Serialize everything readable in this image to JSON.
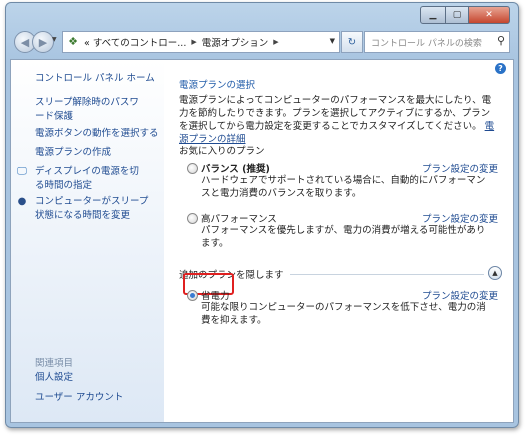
{
  "window": {
    "caption_buttons": {
      "minimize": "▁",
      "maximize": "▢",
      "close": "✕"
    }
  },
  "nav": {
    "back_icon": "◀",
    "forward_icon": "▶",
    "history_icon": "▼",
    "breadcrumbs": [
      "« すべてのコントロー...",
      "電源オプション"
    ],
    "separator": "▶",
    "address_dropdown": "▼",
    "refresh_icon": "↻",
    "search_placeholder": "コントロール パネルの検索",
    "search_icon": "⚲"
  },
  "sidebar": {
    "items": [
      {
        "label": "コントロール パネル ホーム"
      },
      {
        "label": "スリープ解除時のパスワード保護"
      },
      {
        "label": "電源ボタンの動作を選択する"
      },
      {
        "label": "電源プランの作成"
      },
      {
        "label": "ディスプレイの電源を切る時間の指定",
        "icon": "display-icon"
      },
      {
        "label": "コンピューターがスリープ状態になる時間を変更",
        "icon": "moon-icon"
      }
    ],
    "related_heading": "関連項目",
    "related": [
      {
        "label": "個人設定"
      },
      {
        "label": "ユーザー アカウント"
      }
    ]
  },
  "main": {
    "help": "?",
    "title": "電源プランの選択",
    "description": "電源プランによってコンピューターのパフォーマンスを最大にしたり、電力を節約したりできます。プランを選択してアクティブにするか、プランを選択してから電力設定を変更することでカスタマイズしてください。",
    "description_link": "電源プランの詳細",
    "favorites_heading": "お気に入りのプラン",
    "plans": [
      {
        "name": "バランス (推奨)",
        "link": "プラン設定の変更",
        "description": "ハードウェアでサポートされている場合に、自動的にパフォーマンスと電力消費のバランスを取ります。",
        "selected": false
      },
      {
        "name": "高パフォーマンス",
        "link": "プラン設定の変更",
        "description": "パフォーマンスを優先しますが、電力の消費が増える可能性があります。",
        "selected": false
      }
    ],
    "hidden_heading": "追加のプランを隠します",
    "collapse_icon": "▲",
    "extra_plan": {
      "name": "省電力",
      "link": "プラン設定の変更",
      "description": "可能な限りコンピューターのパフォーマンスを低下させ、電力の消費を抑えます。",
      "selected": true
    }
  },
  "colors": {
    "link": "#1f4b91",
    "title": "#1e5aa8",
    "highlight": "#e02020"
  }
}
